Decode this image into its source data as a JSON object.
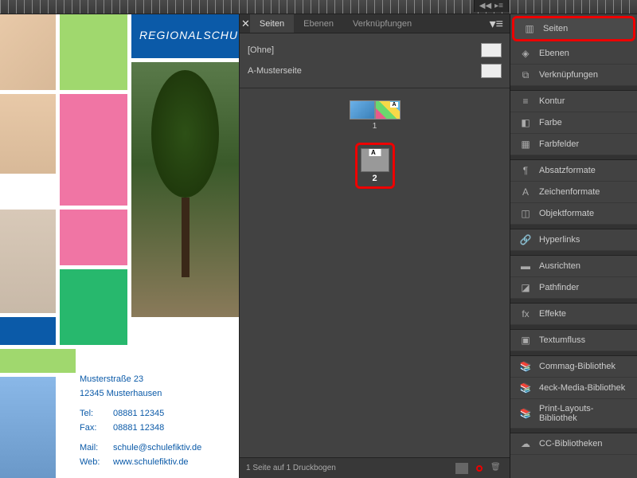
{
  "ruler": {},
  "document": {
    "headline": "REGIONALSCHU",
    "contact": {
      "street": "Musterstraße 23",
      "city": "12345 Musterhausen",
      "tel_label": "Tel:",
      "tel": "08881 12345",
      "fax_label": "Fax:",
      "fax": "08881 12348",
      "mail_label": "Mail:",
      "mail": "schule@schulefiktiv.de",
      "web_label": "Web:",
      "web": "www.schulefiktiv.de"
    }
  },
  "pages_panel": {
    "tabs": [
      "Seiten",
      "Ebenen",
      "Verknüpfungen"
    ],
    "active_tab": 0,
    "masters": [
      {
        "name": "[Ohne]"
      },
      {
        "name": "A-Musterseite"
      }
    ],
    "pages": [
      {
        "num": "1",
        "master": "A",
        "spread": true
      },
      {
        "num": "2",
        "master": "A",
        "spread": false,
        "highlighted": true
      }
    ],
    "footer_status": "1 Seite auf 1 Druckbogen"
  },
  "side_panels": {
    "groups": [
      [
        {
          "id": "seiten",
          "label": "Seiten",
          "icon": "pages-icon",
          "highlighted": true
        },
        {
          "id": "ebenen",
          "label": "Ebenen",
          "icon": "layers-icon"
        },
        {
          "id": "verkn",
          "label": "Verknüpfungen",
          "icon": "links-icon"
        }
      ],
      [
        {
          "id": "kontur",
          "label": "Kontur",
          "icon": "stroke-icon"
        },
        {
          "id": "farbe",
          "label": "Farbe",
          "icon": "color-icon"
        },
        {
          "id": "farbfelder",
          "label": "Farbfelder",
          "icon": "swatches-icon"
        }
      ],
      [
        {
          "id": "absatz",
          "label": "Absatzformate",
          "icon": "paragraph-styles-icon"
        },
        {
          "id": "zeichen",
          "label": "Zeichenformate",
          "icon": "char-styles-icon"
        },
        {
          "id": "objekt",
          "label": "Objektformate",
          "icon": "object-styles-icon"
        }
      ],
      [
        {
          "id": "hyperlinks",
          "label": "Hyperlinks",
          "icon": "hyperlinks-icon"
        }
      ],
      [
        {
          "id": "ausrichten",
          "label": "Ausrichten",
          "icon": "align-icon"
        },
        {
          "id": "pathfinder",
          "label": "Pathfinder",
          "icon": "pathfinder-icon"
        }
      ],
      [
        {
          "id": "effekte",
          "label": "Effekte",
          "icon": "effects-icon"
        }
      ],
      [
        {
          "id": "textumfluss",
          "label": "Textumfluss",
          "icon": "textwrap-icon"
        }
      ],
      [
        {
          "id": "lib1",
          "label": "Commag-Bibliothek",
          "icon": "library-icon"
        },
        {
          "id": "lib2",
          "label": "4eck-Media-Bibliothek",
          "icon": "library-icon"
        },
        {
          "id": "lib3",
          "label": "Print-Layouts-Bibliothek",
          "icon": "library-icon"
        }
      ],
      [
        {
          "id": "cclib",
          "label": "CC-Bibliotheken",
          "icon": "cc-library-icon"
        }
      ]
    ]
  },
  "icons": {
    "pages-icon": "▥",
    "layers-icon": "◈",
    "links-icon": "⧉",
    "stroke-icon": "≡",
    "color-icon": "◧",
    "swatches-icon": "▦",
    "paragraph-styles-icon": "¶",
    "char-styles-icon": "A",
    "object-styles-icon": "◫",
    "hyperlinks-icon": "🔗",
    "align-icon": "▬",
    "pathfinder-icon": "◪",
    "effects-icon": "fx",
    "textwrap-icon": "▣",
    "library-icon": "📚",
    "cc-library-icon": "☁"
  }
}
